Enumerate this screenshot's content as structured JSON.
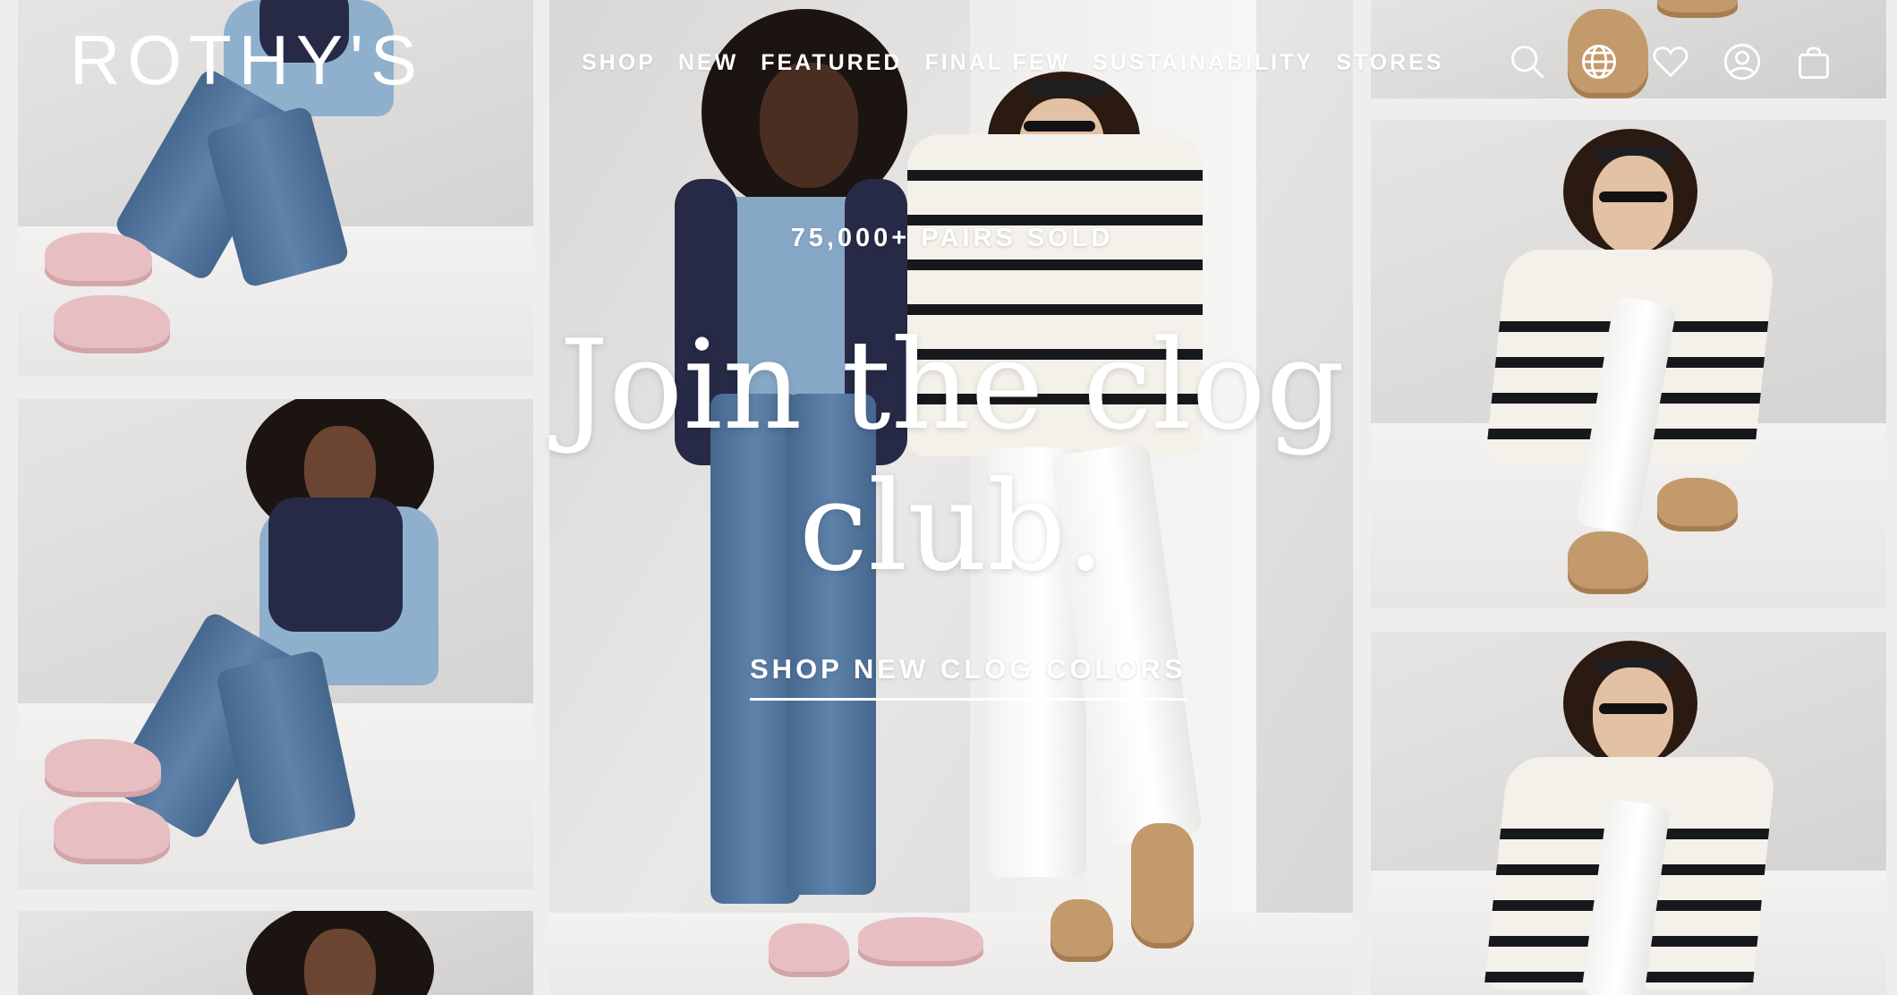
{
  "brand": {
    "logo_text": "ROTHY'S"
  },
  "nav": {
    "items": [
      {
        "label": "SHOP"
      },
      {
        "label": "NEW"
      },
      {
        "label": "FEATURED"
      },
      {
        "label": "FINAL FEW"
      },
      {
        "label": "SUSTAINABILITY"
      },
      {
        "label": "STORES"
      }
    ]
  },
  "header_icons": [
    "search-icon",
    "globe-icon",
    "heart-icon",
    "account-icon",
    "bag-icon"
  ],
  "hero": {
    "eyebrow": "75,000+ PAIRS SOLD",
    "title_line1": "Join the clog",
    "title_line2": "club.",
    "cta": "SHOP NEW CLOG COLORS"
  },
  "colors": {
    "text_on_image": "#ffffff",
    "background": "#efeeec",
    "denim": "#5f82aa",
    "navy": "#262a46",
    "pink_clog": "#e7bfc2",
    "tan_clog": "#c39a6b",
    "stripe": "#17181b"
  }
}
